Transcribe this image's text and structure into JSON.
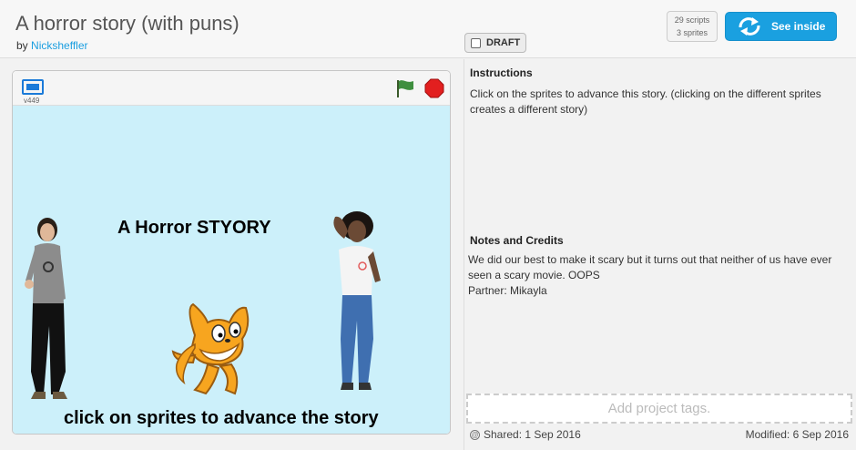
{
  "project": {
    "title": "A horror story (with puns)",
    "by_prefix": "by",
    "author": "Nicksheffler",
    "draft_label": "DRAFT",
    "stats": {
      "scripts": "29 scripts",
      "sprites": "3 sprites"
    },
    "see_inside_label": "See inside"
  },
  "player": {
    "version": "v449",
    "stage_heading": "A Horror STYORY",
    "stage_footer": "click on sprites to advance the story"
  },
  "info": {
    "instructions_heading": "Instructions",
    "instructions_text": "Click on the sprites to advance this story. (clicking on the different sprites creates a different story)",
    "notes_heading": "Notes and Credits",
    "notes_line1": "We did our best to make it scary but it turns out that neither of us have ever seen a scary movie. OOPS",
    "notes_line2": "Partner: Mikayla",
    "tags_placeholder": "Add project tags.",
    "shared": "Shared: 1 Sep 2016",
    "modified": "Modified: 6 Sep 2016"
  },
  "colors": {
    "accent": "#1aa0e0",
    "stage_bg": "#ccf0fa",
    "flag": "#3f8f3f",
    "stop": "#e21f1f"
  }
}
